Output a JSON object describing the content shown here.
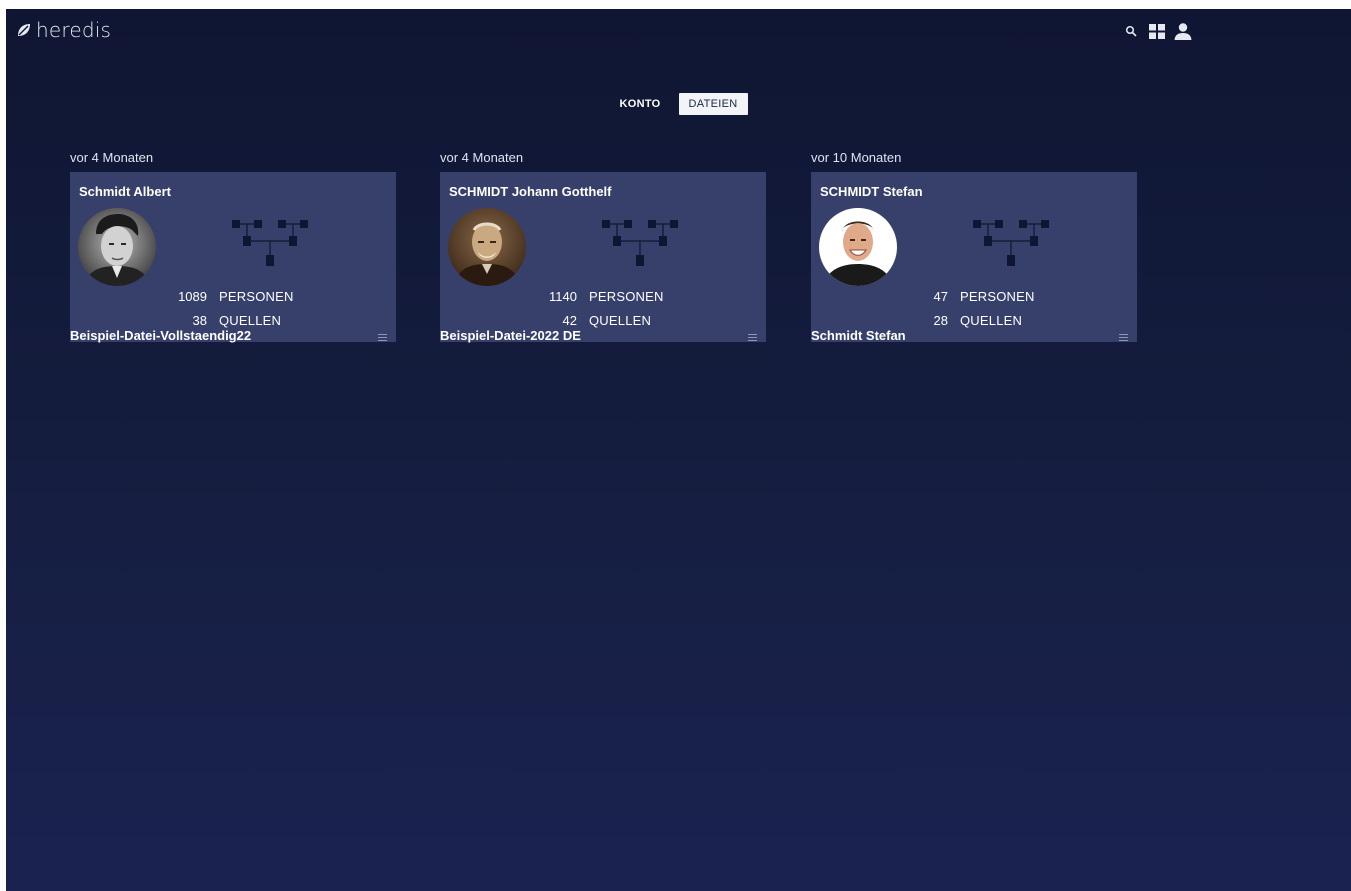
{
  "header": {
    "logo_text": "heredis",
    "tools": [
      "search-icon",
      "grid-icon",
      "user-icon"
    ]
  },
  "tabs": [
    {
      "label": "KONTO",
      "active": false
    },
    {
      "label": "DATEIEN",
      "active": true
    }
  ],
  "files": [
    {
      "date": "vor 4 Monaten",
      "title": "Schmidt Albert",
      "persons": "1089",
      "persons_label": "PERSONEN",
      "sources": "38",
      "sources_label": "QUELLEN",
      "file_name": "Beispiel-Datei-Vollstaendig22"
    },
    {
      "date": "vor 4 Monaten",
      "title": "SCHMIDT Johann Gotthelf",
      "persons": "1140",
      "persons_label": "PERSONEN",
      "sources": "42",
      "sources_label": "QUELLEN",
      "file_name": "Beispiel-Datei-2022 DE"
    },
    {
      "date": "vor 10 Monaten",
      "title": "SCHMIDT Stefan",
      "persons": "47",
      "persons_label": "PERSONEN",
      "sources": "28",
      "sources_label": "QUELLEN",
      "file_name": "Schmidt Stefan"
    }
  ],
  "colors": {
    "background_top": "#0f1633",
    "background_bottom": "#1a2350",
    "card": "#37406a",
    "tab_active_bg": "#f2f4f8"
  }
}
